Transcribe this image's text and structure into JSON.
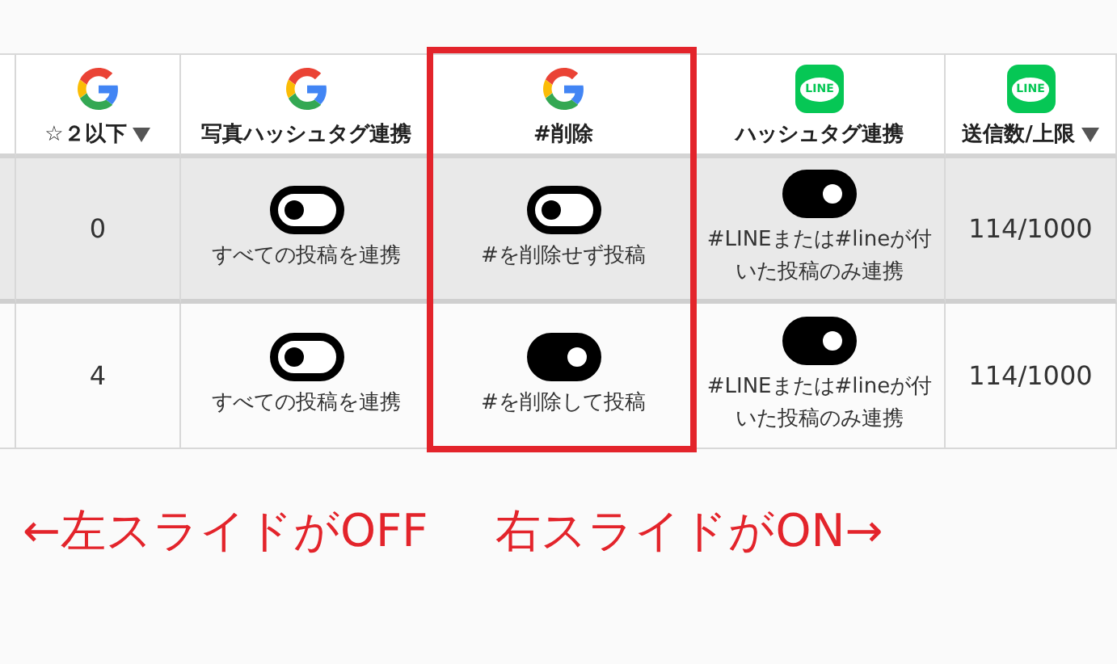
{
  "table": {
    "columns": [
      {
        "kind": "google",
        "label": "☆２以下",
        "sortable": true
      },
      {
        "kind": "google",
        "label": "写真ハッシュタグ連携",
        "sortable": false
      },
      {
        "kind": "google",
        "label": "#削除",
        "sortable": false,
        "highlighted": true
      },
      {
        "kind": "line",
        "logo_text": "LINE",
        "label": "ハッシュタグ連携",
        "sortable": false
      },
      {
        "kind": "line",
        "logo_text": "LINE",
        "label": "送信数/上限",
        "sortable": true
      }
    ],
    "rows": [
      {
        "selected": true,
        "cells": [
          {
            "kind": "text",
            "text": "0"
          },
          {
            "kind": "toggle",
            "on": false,
            "text": "すべての投稿を連携"
          },
          {
            "kind": "toggle",
            "on": false,
            "text": "#を削除せず投稿"
          },
          {
            "kind": "toggle",
            "on": true,
            "text": "#LINEまたは#lineが付いた投稿のみ連携"
          },
          {
            "kind": "text",
            "text": "114/1000"
          }
        ]
      },
      {
        "selected": false,
        "cells": [
          {
            "kind": "text",
            "text": "4"
          },
          {
            "kind": "toggle",
            "on": false,
            "text": "すべての投稿を連携"
          },
          {
            "kind": "toggle",
            "on": true,
            "text": "#を削除して投稿"
          },
          {
            "kind": "toggle",
            "on": true,
            "text": "#LINEまたは#lineが付いた投稿のみ連携"
          },
          {
            "kind": "text",
            "text": "114/1000"
          }
        ]
      }
    ]
  },
  "annotation": {
    "left": "←左スライドがOFF",
    "right": "右スライドがON→"
  }
}
